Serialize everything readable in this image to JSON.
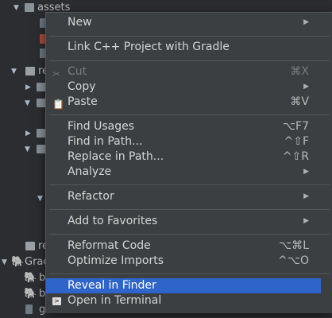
{
  "tree": {
    "assets_label": "assets",
    "res_fragment_1": "re",
    "res_fragment_2": "re",
    "gradle_fragment": "Grac",
    "b_fragment_1": "b",
    "b_fragment_2": "b",
    "g_fragment": "g"
  },
  "menu": {
    "new": "New",
    "link_cpp": "Link C++ Project with Gradle",
    "cut": "Cut",
    "cut_shortcut": "⌘X",
    "copy": "Copy",
    "paste": "Paste",
    "paste_shortcut": "⌘V",
    "find_usages": "Find Usages",
    "find_usages_shortcut": "⌥F7",
    "find_in_path": "Find in Path...",
    "find_in_path_shortcut": "^⇧F",
    "replace_in_path": "Replace in Path...",
    "replace_in_path_shortcut": "^⇧R",
    "analyze": "Analyze",
    "refactor": "Refactor",
    "add_to_favorites": "Add to Favorites",
    "reformat_code": "Reformat Code",
    "reformat_code_shortcut": "⌥⌘L",
    "optimize_imports": "Optimize Imports",
    "optimize_imports_shortcut": "^⌥O",
    "reveal_in_finder": "Reveal in Finder",
    "open_in_terminal": "Open in Terminal",
    "submenu_arrow": "▶"
  },
  "colors": {
    "menu_bg": "#3c3f41",
    "selected_bg": "#2f65ca",
    "tree_bg": "#2b2d30"
  }
}
